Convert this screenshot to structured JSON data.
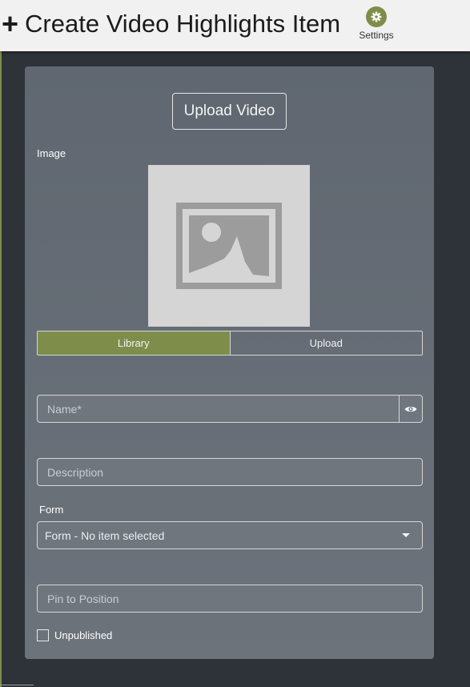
{
  "header": {
    "plus_symbol": "+",
    "title": "Create Video Highlights Item",
    "settings_label": "Settings"
  },
  "form": {
    "upload_video_label": "Upload Video",
    "image_label": "Image",
    "image_source_tabs": [
      {
        "label": "Library",
        "active": true
      },
      {
        "label": "Upload",
        "active": false
      }
    ],
    "name_placeholder": "Name*",
    "name_value": "",
    "description_placeholder": "Description",
    "description_value": "",
    "form_label": "Form",
    "form_select_value": "Form - No item selected",
    "pin_placeholder": "Pin to Position",
    "pin_value": "",
    "unpublished_label": "Unpublished",
    "unpublished_checked": false
  },
  "colors": {
    "accent": "#7e8e4a",
    "header_bg": "#f1f1f1",
    "panel_bg": "#646b74",
    "page_bg": "#2d3339"
  },
  "icons": {
    "settings": "gear-icon",
    "image_placeholder": "image-placeholder-icon",
    "visibility": "eye-icon",
    "dropdown": "caret-down-icon"
  }
}
